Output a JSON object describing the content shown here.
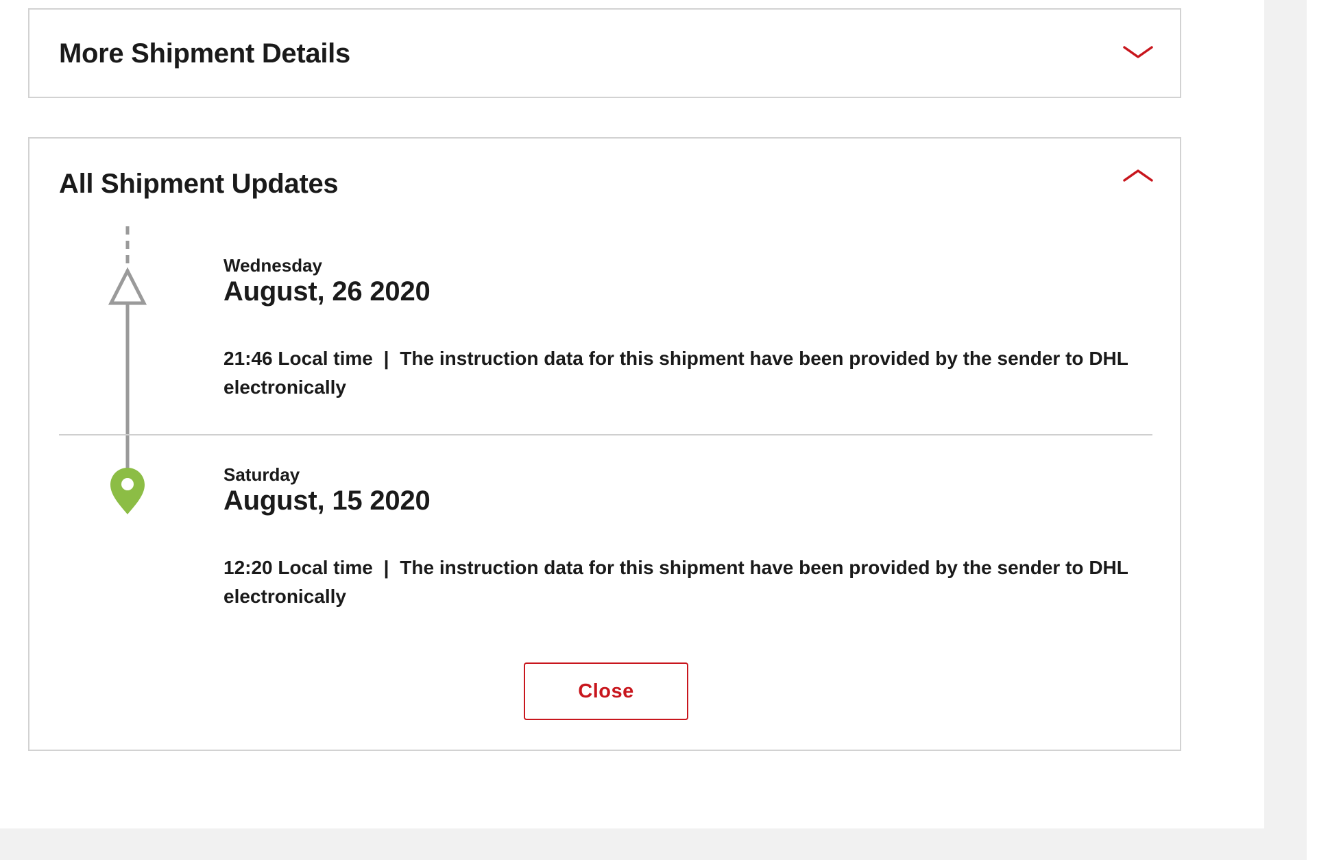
{
  "more_details": {
    "title": "More Shipment Details",
    "toggle_icon": "chevron-down-icon"
  },
  "updates": {
    "title": "All Shipment Updates",
    "toggle_icon": "chevron-up-icon",
    "events": [
      {
        "weekday": "Wednesday",
        "date": "August, 26 2020",
        "time": "21:46 Local time",
        "separator": "|",
        "description": "The instruction data for this shipment have been provided by the sender to DHL electronically",
        "marker_icon": "triangle-outline-icon"
      },
      {
        "weekday": "Saturday",
        "date": "August, 15 2020",
        "time": "12:20 Local time",
        "separator": "|",
        "description": "The instruction data for this shipment have been provided by the sender to DHL electronically",
        "marker_icon": "location-pin-icon"
      }
    ],
    "close_label": "Close"
  },
  "colors": {
    "accent_red": "#c8161d",
    "timeline_gray": "#9a9a9a",
    "pin_green": "#8cbd45",
    "border_gray": "#d2d2d2",
    "side_gray": "#f1f1f1"
  }
}
